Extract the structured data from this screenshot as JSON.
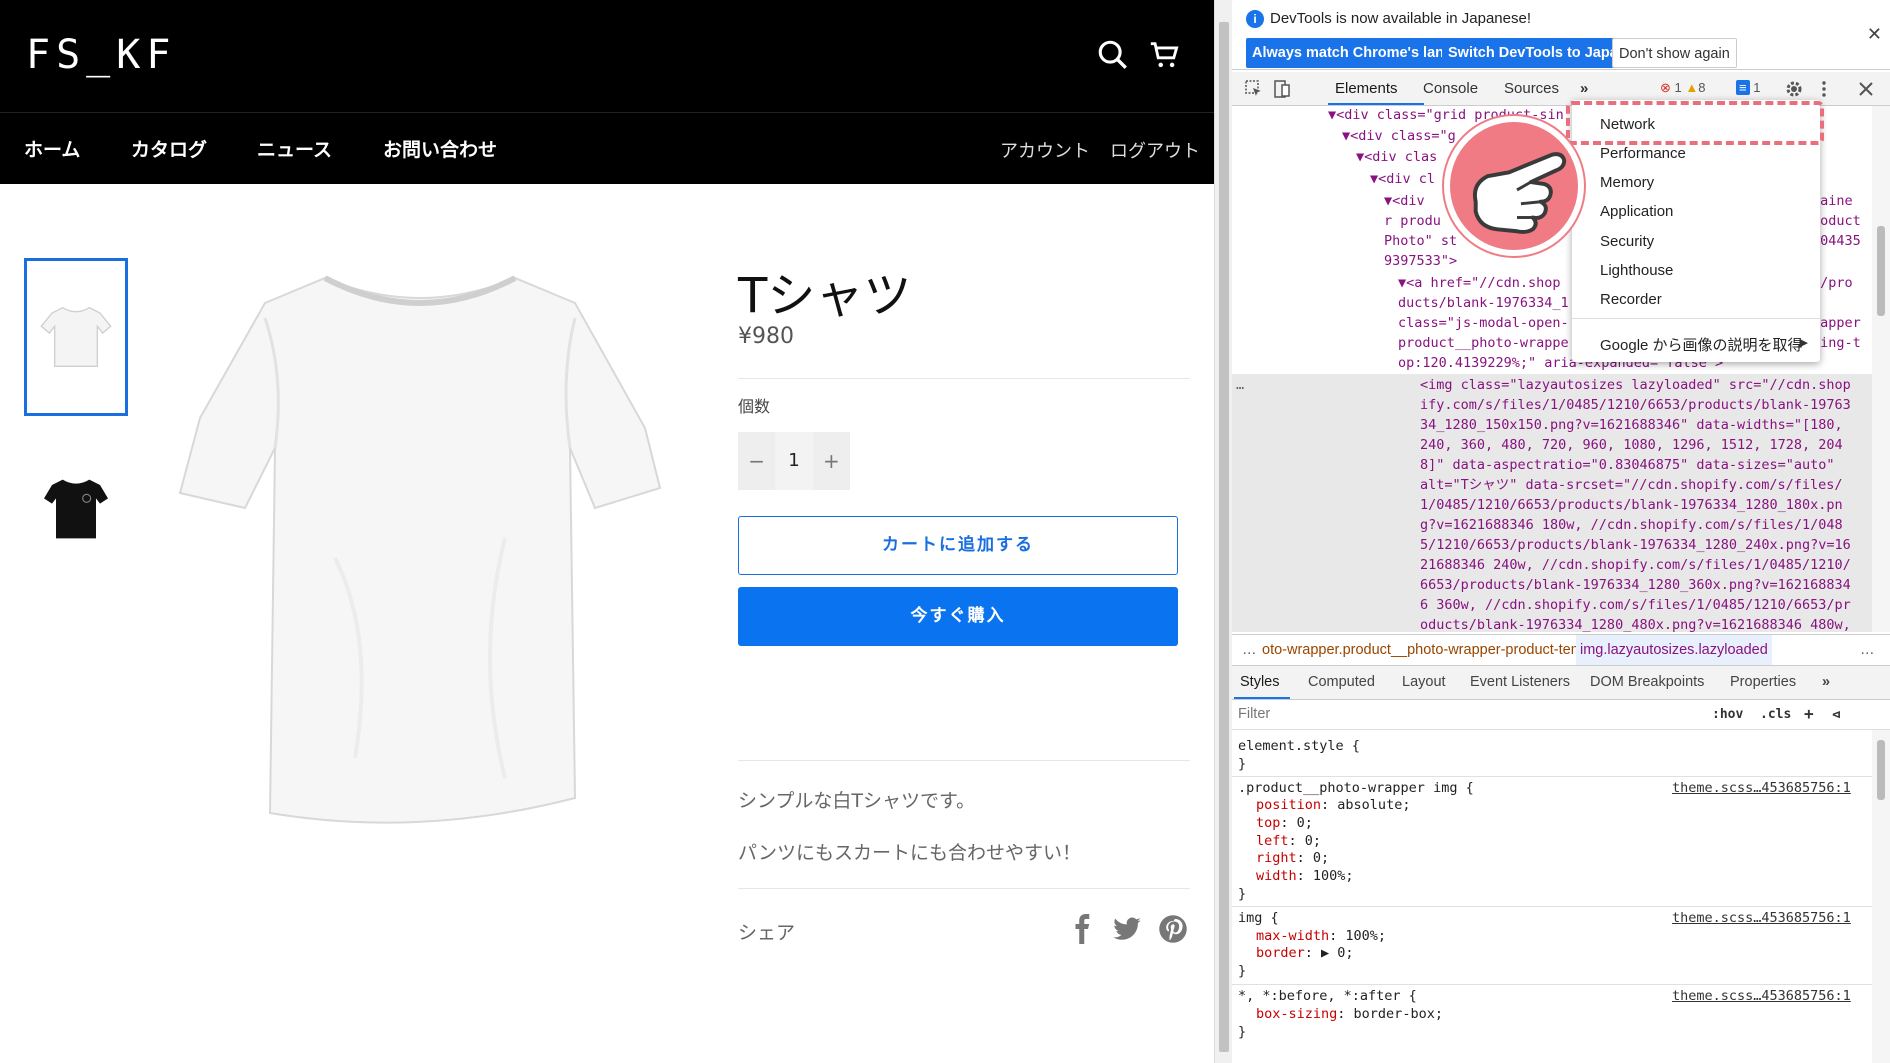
{
  "store": {
    "logo": "FS_KF",
    "nav": [
      "ホーム",
      "カタログ",
      "ニュース",
      "お問い合わせ"
    ],
    "nav_right": [
      "アカウント",
      "ログアウト"
    ],
    "product": {
      "title": "Tシャツ",
      "price": "¥980",
      "qty_label": "個数",
      "qty_minus": "−",
      "qty_value": "1",
      "qty_plus": "+",
      "add_to_cart": "カートに追加する",
      "buy_now": "今すぐ購入",
      "desc1": "シンプルな白Tシャツです。",
      "desc2": "パンツにもスカートにも合わせやすい！",
      "share": "シェア"
    }
  },
  "devtools": {
    "info_text": "DevTools is now available in Japanese!",
    "btn_match": "Always match Chrome's language",
    "btn_switch": "Switch DevTools to Japanese",
    "btn_dont": "Don't show again",
    "tabs": [
      "Elements",
      "Console",
      "Sources"
    ],
    "more_tabs": "»",
    "errors": "1",
    "warnings": "8",
    "messages": "1",
    "menu": [
      "Network",
      "Performance",
      "Memory",
      "Application",
      "Security",
      "Lighthouse",
      "Recorder",
      "Google から画像の説明を取得"
    ],
    "breadcrumbs": [
      "oto-wrapper.product__photo-wrapper-product-template",
      "img.lazyautosizes.lazyloaded"
    ],
    "style_tabs": [
      "Styles",
      "Computed",
      "Layout",
      "Event Listeners",
      "DOM Breakpoints",
      "Properties"
    ],
    "filter_placeholder": "Filter",
    "filter_tools": [
      ":hov",
      ".cls",
      "+"
    ],
    "source_link": "theme.scss…453685756:1",
    "dom_lines": [
      "▼<div class=\"grid product-sin",
      "▼<div class=\"g",
      "▼<div clas",
      "▼<div cl",
      "▼<div",
      "r produ",
      "Photo\" st",
      "9397533\">",
      "▼<a href=\"//cdn.shop",
      "ducts/blank-1976334_1",
      "class=\"js-modal-open-",
      "product__photo-wrappe",
      "op:120.4139229%;\" aria-expanded=\"false\">"
    ],
    "dom_right": [
      "taine",
      "roduct",
      "904435",
      "3/pro",
      "rapper",
      "ding-t"
    ],
    "img_lines": [
      "<img class=\"lazyautosizes lazyloaded\" src=\"//cdn.shop",
      "ify.com/s/files/1/0485/1210/6653/products/blank-19763",
      "34_1280_150x150.png?v=1621688346\" data-widths=\"[180,",
      "240, 360, 480, 720, 960, 1080, 1296, 1512, 1728, 204",
      "8]\" data-aspectratio=\"0.83046875\" data-sizes=\"auto\"",
      "alt=\"Tシャツ\" data-srcset=\"//cdn.shopify.com/s/files/",
      "1/0485/1210/6653/products/blank-1976334_1280_180x.pn",
      "g?v=1621688346 180w, //cdn.shopify.com/s/files/1/048",
      "5/1210/6653/products/blank-1976334_1280_240x.png?v=16",
      "21688346 240w, //cdn.shopify.com/s/files/1/0485/1210/",
      "6653/products/blank-1976334_1280_360x.png?v=162168834",
      "6 360w, //cdn.shopify.com/s/files/1/0485/1210/6653/pr",
      "oducts/blank-1976334_1280_480x.png?v=1621688346 480w,"
    ],
    "styles": {
      "element_style": "element.style {",
      "close": "}",
      "rule1_selector": ".product__photo-wrapper img {",
      "rule1_props": [
        [
          "position",
          "absolute;"
        ],
        [
          "top",
          "0;"
        ],
        [
          "left",
          "0;"
        ],
        [
          "right",
          "0;"
        ],
        [
          "width",
          "100%;"
        ]
      ],
      "rule2_selector": "img {",
      "rule2_props": [
        [
          "max-width",
          "100%;"
        ],
        [
          "border",
          "▶ 0;"
        ]
      ],
      "rule3_selector": "*, *:before, *:after {",
      "rule3_props": [
        [
          "box-sizing",
          "border-box;"
        ]
      ]
    }
  },
  "colors": {
    "accent": "#1a6fe0",
    "buy_button": "#0a73f0",
    "highlight": "#ea6f7d"
  }
}
